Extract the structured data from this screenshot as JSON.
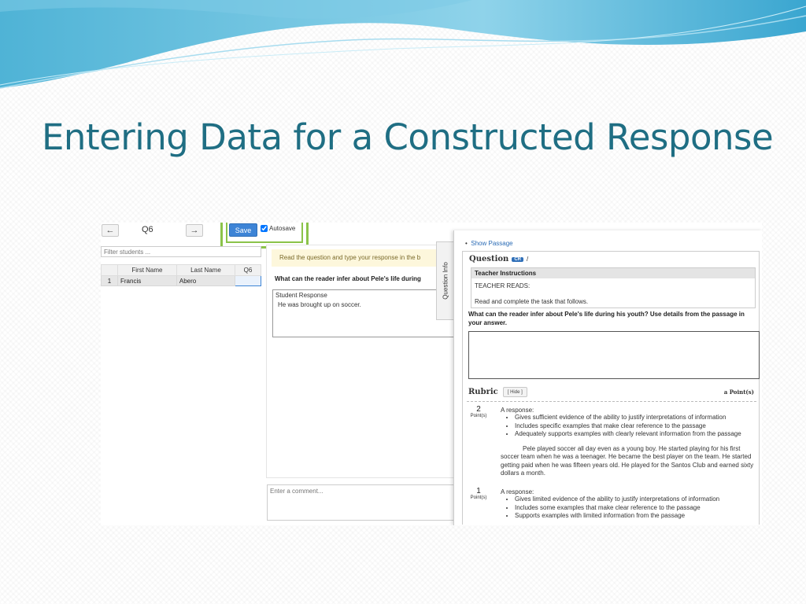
{
  "slide": {
    "title": "Entering Data for a Constructed Response"
  },
  "colors": {
    "title": "#1f6e83",
    "save": "#3d84d6",
    "highlight": "#8bc34a",
    "link": "#2a6bb5"
  },
  "nav": {
    "question_label": "Q6",
    "prev_icon": "arrow-left-icon",
    "next_icon": "arrow-right-icon"
  },
  "toolbar": {
    "save_label": "Save",
    "autosave_label": "Autosave",
    "autosave_checked": true
  },
  "filter": {
    "placeholder": "Filter students ..."
  },
  "grid": {
    "headers": [
      "",
      "First Name",
      "Last Name",
      "Q6"
    ],
    "rows": [
      {
        "num": "1",
        "first": "Francis",
        "last": "Abero",
        "q6": ""
      }
    ]
  },
  "response_panel": {
    "instruction": "Read the question and type your response in the b",
    "question": "What can the reader infer about Pele's life during",
    "student_response_label": "Student Response",
    "student_response_text": "He was brought up on soccer.",
    "comment_placeholder": "Enter a comment..."
  },
  "question_info_tab": "Question Info",
  "right_panel": {
    "show_passage": "Show Passage",
    "question_title": "Question",
    "question_badge": "CR",
    "question_slash": "/",
    "teacher_instructions_header": "Teacher Instructions",
    "teacher_reads": "TEACHER READS:",
    "read_complete": "Read and complete the task that follows.",
    "question_text": "What can the reader infer about Pele's life during his youth?  Use details from the passage in your answer.",
    "rubric_title": "Rubric",
    "hide_label": "[ Hide ]",
    "points_header": "a Point(s)",
    "rubric": [
      {
        "score": "2",
        "points_label": "Point(s)",
        "lead": "A response:",
        "bullets": [
          "Gives sufficient evidence of the ability to justify interpretations of information",
          "Includes specific examples that make clear reference to the passage",
          "Adequately supports examples with clearly relevant information from the passage"
        ],
        "example": "Pele played soccer all day even as a young boy. He started playing for his first soccer team when he was a teenager. He became the best player on the team. He started getting paid when he was fifteen years old. He played for the Santos Club and earned sixty dollars a month."
      },
      {
        "score": "1",
        "points_label": "Point(s)",
        "lead": "A response:",
        "bullets": [
          "Gives limited evidence of the ability to justify interpretations of information",
          "Includes some examples that make clear reference to the passage",
          "Supports examples with limited information from the passage"
        ]
      }
    ]
  }
}
